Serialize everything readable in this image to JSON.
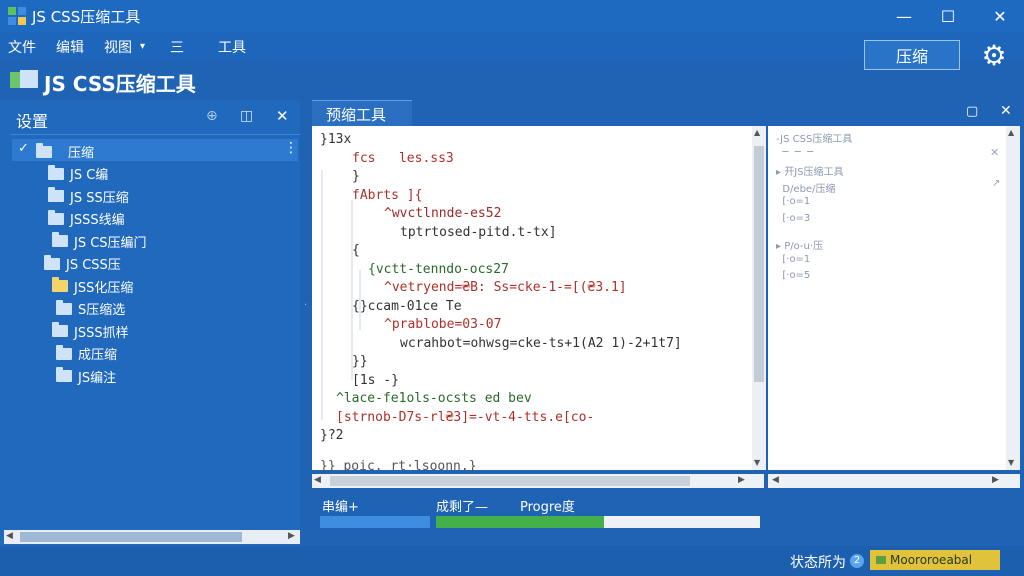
{
  "window": {
    "title": "JS CSS压缩工具",
    "min": "—",
    "max": "☐",
    "close": "✕"
  },
  "menu": {
    "items": [
      "文件",
      "编辑",
      "视图",
      "三",
      "工具"
    ],
    "view_arrow": "▾"
  },
  "header": {
    "title": "JS CSS压缩工具",
    "compress_button": "压缩",
    "gear": "⚙"
  },
  "sidebar": {
    "title": "设置",
    "pin": "⊕",
    "dock": "◫",
    "close": "✕",
    "root_label": "压缩",
    "root_arrow": "✓",
    "root_grip": "⋮",
    "items": [
      {
        "label": "JS C编",
        "color": "blue"
      },
      {
        "label": "JS SS压缩",
        "color": "blue"
      },
      {
        "label": "JSSS线编",
        "color": "blue"
      },
      {
        "label": "JS CS压编门",
        "color": "blue"
      },
      {
        "label": "JS CSS压",
        "color": "blue"
      },
      {
        "label": "JSS化压缩",
        "color": "yellow"
      },
      {
        "label": "S压缩选",
        "color": "blue"
      },
      {
        "label": "JSSS抓样",
        "color": "blue"
      },
      {
        "label": "成压缩",
        "color": "blue"
      },
      {
        "label": "JS编注",
        "color": "blue"
      }
    ],
    "scroll_left": "◀",
    "scroll_right": "▶"
  },
  "editor": {
    "tab": "预缩工具",
    "tab_icon": "▢",
    "tab_close": "✕",
    "lines": [
      {
        "text": "}13x",
        "indent": 0,
        "color": "#333"
      },
      {
        "text": "fcs   les.ss3",
        "indent": 2,
        "color": "#b0302a"
      },
      {
        "text": "}",
        "indent": 2,
        "color": "#333"
      },
      {
        "text": "fAbrts ]{",
        "indent": 2,
        "color": "#b0302a"
      },
      {
        "text": "^wvctlnnde-es52",
        "indent": 4,
        "color": "#a0282a"
      },
      {
        "text": "tptrtosed-pitd.t-tx]",
        "indent": 5,
        "color": "#333"
      },
      {
        "text": "{",
        "indent": 2,
        "color": "#333"
      },
      {
        "text": "{vctt-tenndo-ocs27",
        "indent": 3,
        "color": "#2a6a2a"
      },
      {
        "text": "^vetryend=₴B: Ss=cke-1-=[(₴3.1]",
        "indent": 4,
        "color": "#b0302a"
      },
      {
        "text": "{}ccam-01ce Te",
        "indent": 2,
        "color": "#333"
      },
      {
        "text": "^prablobe=03-07",
        "indent": 4,
        "color": "#b0302a"
      },
      {
        "text": "wcrahbot=ohwsg=cke-ts+1(A2 1)-2+1t7]",
        "indent": 5,
        "color": "#333"
      },
      {
        "text": "}}",
        "indent": 2,
        "color": "#333"
      },
      {
        "text": "[1s -}",
        "indent": 2,
        "color": "#333"
      },
      {
        "text": "^lace-fe1ols-ocsts ed bev",
        "indent": 1,
        "color": "#2a6a2a"
      },
      {
        "text": "[strnob-D7s-rl₴3]=-vt-4-tts.e[co-",
        "indent": 1,
        "color": "#b0302a"
      },
      {
        "text": "}?2",
        "indent": 0,
        "color": "#333"
      },
      {
        "text": "}} poic. rt·lsoonn.}",
        "indent": 0,
        "color": "#555"
      }
    ],
    "scroll_up": "▲",
    "scroll_down": "▼",
    "scroll_left": "◀",
    "scroll_right": "▶"
  },
  "output_pane": {
    "lines": [
      "-JS CSS压缩工具",
      "  ─  ─  ─",
      "▸ 开JS压缩工具",
      "  D/ebe/压缩",
      "  [·o=1",
      "  [·o=3",
      "▸ P/o-u·压",
      "  [·o=1",
      "  [·o=5"
    ],
    "close": "✕",
    "arrow": "↗",
    "scroll_up": "▲",
    "scroll_down": "▼",
    "scroll_left": "◀",
    "scroll_right": "▶"
  },
  "progress": {
    "label1": "串编+",
    "label2": "成剩了—",
    "label3": "Progre度",
    "bar1": 1.0,
    "bar2": 0.52
  },
  "status": {
    "label": "状态所为",
    "badge": "2",
    "text": "Moororoeabal"
  }
}
